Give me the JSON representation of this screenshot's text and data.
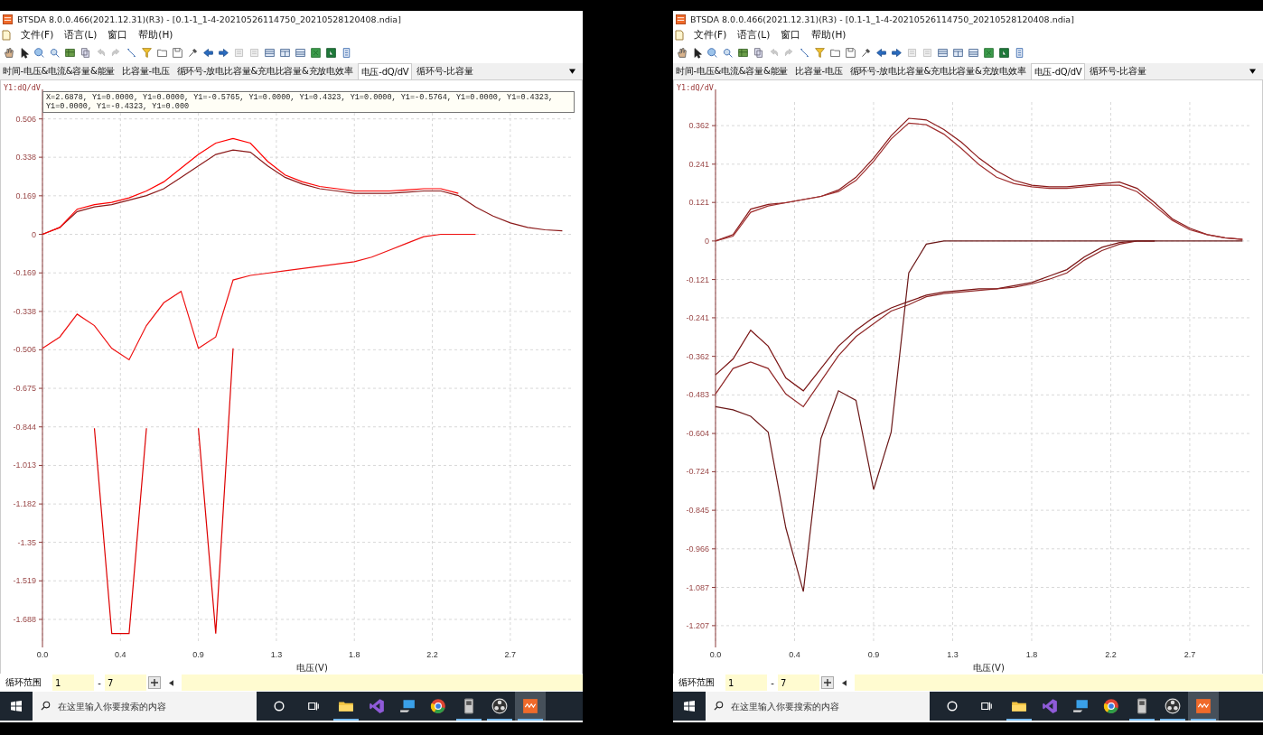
{
  "panels": [
    {
      "window": {
        "title": "BTSDA 8.0.0.466(2021.12.31)(R3) - [0.1-1_1-4-20210526114750_20210528120408.ndia]"
      },
      "menu": [
        "文件(F)",
        "语言(L)",
        "窗口",
        "帮助(H)"
      ],
      "tabs": [
        {
          "label": "时间-电压&电流&容量&能量",
          "selected": false
        },
        {
          "label": "比容量-电压",
          "selected": false
        },
        {
          "label": "循环号-放电比容量&充电比容量&充放电效率",
          "selected": false
        },
        {
          "label": "电压-dQ/dV",
          "selected": true
        },
        {
          "label": "循环号-比容量",
          "selected": false
        }
      ],
      "chart": {
        "readout": "X=2.6878, Y1=0.0000, Y1=0.0000, Y1=-0.5765, Y1=0.0000, Y1=0.4323, Y1=0.0000, Y1=-0.5764, Y1=0.0000, Y1=0.4323, Y1=0.0000, Y1=-0.4323, Y1=0.000",
        "chart_data": {
          "type": "line",
          "grid": true,
          "xlabel": "电压(V)",
          "ylabel": "Y1:dQ/dV",
          "x": [
            0,
            0.1,
            0.2,
            0.3,
            0.4,
            0.5,
            0.6,
            0.7,
            0.8,
            0.9,
            1.0,
            1.1,
            1.2,
            1.3,
            1.4,
            1.5,
            1.6,
            1.7,
            1.8,
            1.9,
            2.0,
            2.1,
            2.2,
            2.3,
            2.4,
            2.5,
            2.6,
            2.7,
            2.8,
            2.9,
            3.0
          ],
          "xlim": [
            0,
            3.05
          ],
          "ylim": [
            -1.795,
            0.58
          ],
          "xticks": [
            {
              "value": 0,
              "label": "0.0"
            },
            {
              "value": 0.45,
              "label": "0.4"
            },
            {
              "value": 0.9,
              "label": "0.9"
            },
            {
              "value": 1.35,
              "label": "1.3"
            },
            {
              "value": 1.8,
              "label": "1.8"
            },
            {
              "value": 2.25,
              "label": "2.2"
            },
            {
              "value": 2.7,
              "label": "2.7"
            }
          ],
          "yticks": [
            0.506,
            0.338,
            0.169,
            0,
            -0.169,
            -0.338,
            -0.506,
            -0.675,
            -0.844,
            -1.013,
            -1.182,
            -1.35,
            -1.519,
            -1.688
          ],
          "series": [
            {
              "color": "#8b1a1a",
              "values": [
                0,
                0.03,
                0.1,
                0.12,
                0.13,
                0.15,
                0.17,
                0.2,
                0.25,
                0.3,
                0.35,
                0.37,
                0.36,
                0.3,
                0.25,
                0.22,
                0.2,
                0.19,
                0.18,
                0.18,
                0.18,
                0.185,
                0.19,
                0.19,
                0.17,
                0.12,
                0.08,
                0.05,
                0.03,
                0.02,
                0.015
              ]
            },
            {
              "color": "#ff0000",
              "values": [
                0,
                0.03,
                0.11,
                0.13,
                0.14,
                0.16,
                0.19,
                0.23,
                0.29,
                0.35,
                0.4,
                0.42,
                0.4,
                0.32,
                0.26,
                0.23,
                0.21,
                0.2,
                0.19,
                0.19,
                0.19,
                0.195,
                0.2,
                0.2,
                0.18,
                null,
                null,
                null,
                null,
                null,
                null
              ]
            },
            {
              "color": "#ee1111",
              "values": [
                -0.5,
                -0.45,
                -0.35,
                -0.4,
                -0.5,
                -0.55,
                -0.4,
                -0.3,
                -0.25,
                -0.5,
                -0.45,
                -0.2,
                -0.18,
                -0.17,
                -0.16,
                -0.15,
                -0.14,
                -0.13,
                -0.12,
                -0.1,
                -0.07,
                -0.04,
                -0.01,
                0,
                0,
                0,
                null,
                null,
                null,
                null,
                null
              ]
            },
            {
              "color": "#dd0000",
              "values": [
                null,
                null,
                null,
                -0.85,
                -1.75,
                -1.75,
                -0.85,
                null,
                null,
                -0.85,
                -1.75,
                -0.5,
                null,
                null,
                null,
                null,
                null,
                null,
                null,
                null,
                null,
                null,
                null,
                null,
                null,
                null,
                null,
                null,
                null,
                null,
                null
              ]
            }
          ]
        }
      },
      "bottom_bar": {
        "label": "循环范围",
        "from": "1",
        "separator": "-",
        "to": "7"
      },
      "taskbar": {
        "placeholder": "在这里输入你要搜索的内容",
        "apps": [
          {
            "kind": "folder",
            "running": true,
            "selected": false
          },
          {
            "kind": "studio",
            "running": false,
            "selected": false
          },
          {
            "kind": "pc",
            "running": false,
            "selected": false
          },
          {
            "kind": "chrome",
            "running": false,
            "selected": false
          },
          {
            "kind": "phone",
            "running": true,
            "selected": false
          },
          {
            "kind": "obs",
            "running": true,
            "selected": false
          },
          {
            "kind": "tester",
            "running": true,
            "selected": true
          }
        ]
      }
    },
    {
      "window": {
        "title": "BTSDA 8.0.0.466(2021.12.31)(R3) - [0.1-1_1-4-20210526114750_20210528120408.ndia]"
      },
      "menu": [
        "文件(F)",
        "语言(L)",
        "窗口",
        "帮助(H)"
      ],
      "tabs": [
        {
          "label": "时间-电压&电流&容量&能量",
          "selected": false
        },
        {
          "label": "比容量-电压",
          "selected": false
        },
        {
          "label": "循环号-放电比容量&充电比容量&充放电效率",
          "selected": false
        },
        {
          "label": "电压-dQ/dV",
          "selected": true
        },
        {
          "label": "循环号-比容量",
          "selected": false
        }
      ],
      "chart": {
        "chart_data": {
          "type": "line",
          "grid": true,
          "xlabel": "电压(V)",
          "ylabel": "Y1:dQ/dV",
          "x": [
            0,
            0.1,
            0.2,
            0.3,
            0.4,
            0.5,
            0.6,
            0.7,
            0.8,
            0.9,
            1.0,
            1.1,
            1.2,
            1.3,
            1.4,
            1.5,
            1.6,
            1.7,
            1.8,
            1.9,
            2.0,
            2.1,
            2.2,
            2.3,
            2.4,
            2.5,
            2.6,
            2.7,
            2.8,
            2.9,
            3.0
          ],
          "xlim": [
            0,
            3.05
          ],
          "ylim": [
            -1.264,
            0.436
          ],
          "xticks": [
            {
              "value": 0,
              "label": "0.0"
            },
            {
              "value": 0.45,
              "label": "0.4"
            },
            {
              "value": 0.9,
              "label": "0.9"
            },
            {
              "value": 1.35,
              "label": "1.3"
            },
            {
              "value": 1.8,
              "label": "1.8"
            },
            {
              "value": 2.25,
              "label": "2.2"
            },
            {
              "value": 2.7,
              "label": "2.7"
            }
          ],
          "yticks": [
            0.362,
            0.241,
            0.121,
            0,
            -0.121,
            -0.241,
            -0.362,
            -0.483,
            -0.604,
            -0.724,
            -0.845,
            -0.966,
            -1.087,
            -1.207
          ],
          "series": [
            {
              "color": "#8b1a1a",
              "values": [
                0,
                0.02,
                0.1,
                0.115,
                0.12,
                0.13,
                0.14,
                0.16,
                0.2,
                0.26,
                0.33,
                0.385,
                0.38,
                0.35,
                0.31,
                0.26,
                0.22,
                0.19,
                0.175,
                0.17,
                0.17,
                0.175,
                0.18,
                0.185,
                0.165,
                0.12,
                0.07,
                0.04,
                0.02,
                0.01,
                0.005
              ]
            },
            {
              "color": "#a03030",
              "values": [
                0,
                0.015,
                0.09,
                0.11,
                0.12,
                0.13,
                0.14,
                0.155,
                0.19,
                0.25,
                0.32,
                0.37,
                0.365,
                0.335,
                0.29,
                0.24,
                0.2,
                0.18,
                0.17,
                0.165,
                0.165,
                0.17,
                0.175,
                0.175,
                0.155,
                0.11,
                0.065,
                0.035,
                0.02,
                0.01,
                0.005
              ]
            },
            {
              "color": "#7a1515",
              "values": [
                -0.42,
                -0.37,
                -0.28,
                -0.33,
                -0.43,
                -0.47,
                -0.4,
                -0.33,
                -0.28,
                -0.24,
                -0.21,
                -0.19,
                -0.17,
                -0.16,
                -0.155,
                -0.15,
                -0.15,
                -0.14,
                -0.13,
                -0.11,
                -0.09,
                -0.05,
                -0.02,
                -0.005,
                0,
                0,
                null,
                null,
                null,
                null,
                null
              ]
            },
            {
              "color": "#902828",
              "values": [
                -0.48,
                -0.4,
                -0.38,
                -0.4,
                -0.48,
                -0.52,
                -0.44,
                -0.36,
                -0.3,
                -0.26,
                -0.22,
                -0.2,
                -0.175,
                -0.165,
                -0.16,
                -0.155,
                -0.15,
                -0.145,
                -0.135,
                -0.12,
                -0.1,
                -0.06,
                -0.03,
                -0.01,
                0,
                0,
                null,
                null,
                null,
                null,
                null
              ]
            },
            {
              "color": "#6b1818",
              "values": [
                -0.52,
                -0.53,
                -0.55,
                -0.6,
                -0.9,
                -1.1,
                -0.62,
                -0.47,
                -0.5,
                -0.78,
                -0.6,
                -0.1,
                -0.01,
                0,
                0,
                0,
                0,
                0,
                0,
                0,
                0,
                0,
                0,
                0,
                0,
                0,
                0,
                0,
                0,
                0,
                0
              ]
            }
          ]
        }
      },
      "bottom_bar": {
        "label": "循环范围",
        "from": "1",
        "separator": "-",
        "to": "7"
      },
      "taskbar": {
        "placeholder": "在这里输入你要搜索的内容",
        "apps": [
          {
            "kind": "folder",
            "running": true,
            "selected": false
          },
          {
            "kind": "studio",
            "running": false,
            "selected": false
          },
          {
            "kind": "pc",
            "running": false,
            "selected": false
          },
          {
            "kind": "chrome",
            "running": false,
            "selected": false
          },
          {
            "kind": "phone",
            "running": true,
            "selected": false
          },
          {
            "kind": "obs",
            "running": true,
            "selected": false
          },
          {
            "kind": "tester",
            "running": true,
            "selected": true
          }
        ]
      }
    }
  ]
}
